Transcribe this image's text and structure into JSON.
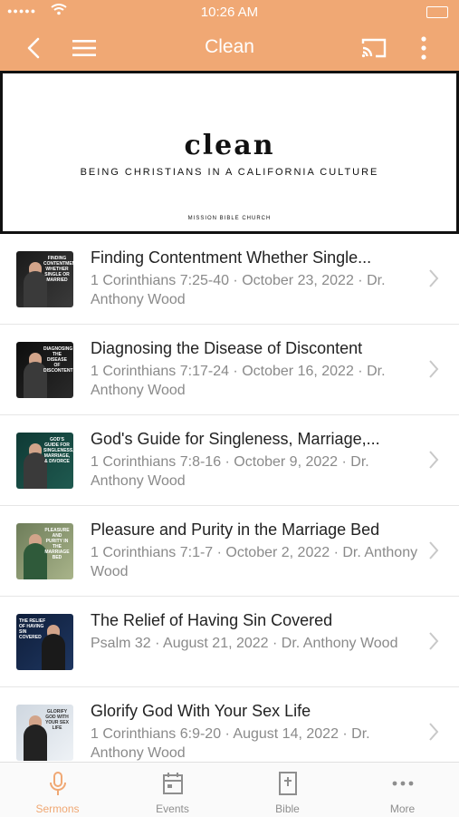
{
  "status_bar": {
    "time": "10:26 AM",
    "signal": "●●●●●"
  },
  "nav": {
    "title": "Clean",
    "back_icon": "chevron-left-icon",
    "menu_icon": "hamburger-icon",
    "cast_icon": "cast-icon",
    "more_icon": "vertical-dots-icon"
  },
  "hero": {
    "title": "clean",
    "subtitle": "BEING CHRISTIANS IN A CALIFORNIA CULTURE",
    "footer": "MISSION BIBLE CHURCH"
  },
  "sermons": [
    {
      "title": "Finding Contentment Whether Single...",
      "subtitle": "1 Corinthians 7:25-40 · October 23, 2022 · Dr. Anthony Wood",
      "thumb_text": "FINDING CONTENTMENT WHETHER SINGLE OR MARRIED"
    },
    {
      "title": "Diagnosing the Disease of Discontent",
      "subtitle": "1 Corinthians 7:17-24 · October 16, 2022 · Dr. Anthony Wood",
      "thumb_text": "DIAGNOSING THE DISEASE OF DISCONTENT"
    },
    {
      "title": "God's Guide for Singleness, Marriage,...",
      "subtitle": "1 Corinthians 7:8-16 · October 9, 2022 · Dr. Anthony Wood",
      "thumb_text": "GOD'S GUIDE FOR SINGLENESS, MARRIAGE, & DIVORCE"
    },
    {
      "title": "Pleasure and Purity in the Marriage Bed",
      "subtitle": "1 Corinthians 7:1-7 · October 2, 2022 · Dr. Anthony Wood",
      "thumb_text": "PLEASURE AND PURITY IN THE MARRIAGE BED"
    },
    {
      "title": "The Relief of Having Sin Covered",
      "subtitle": "Psalm 32 · August 21, 2022 · Dr. Anthony Wood",
      "thumb_text": "THE RELIEF OF HAVING SIN COVERED"
    },
    {
      "title": "Glorify God With Your Sex Life",
      "subtitle": "1 Corinthians 6:9-20 · August 14, 2022 · Dr. Anthony Wood",
      "thumb_text": "GLORIFY GOD WITH YOUR SEX LIFE"
    }
  ],
  "tabs": [
    {
      "label": "Sermons",
      "icon": "microphone-icon"
    },
    {
      "label": "Events",
      "icon": "calendar-icon"
    },
    {
      "label": "Bible",
      "icon": "bible-icon"
    },
    {
      "label": "More",
      "icon": "more-dots-icon"
    }
  ],
  "colors": {
    "accent": "#f0a874",
    "text": "#222222",
    "muted": "#8a8a8a"
  }
}
